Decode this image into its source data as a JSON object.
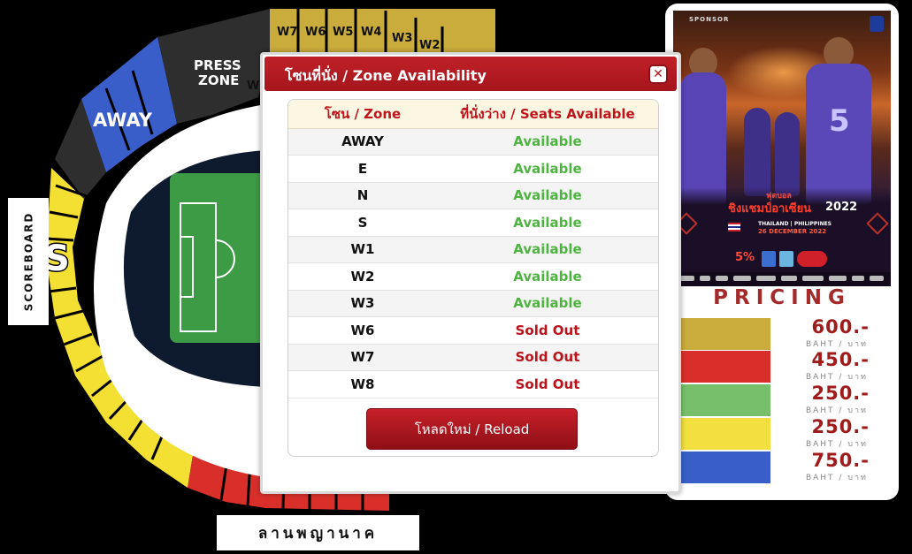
{
  "stadium": {
    "labels": {
      "away": "AWAY",
      "press": "PRESS",
      "press_zone": "ZONE",
      "s": "S",
      "w_partial": "W",
      "w_sections": [
        "W7",
        "W6",
        "W5",
        "W4",
        "W3",
        "W2"
      ]
    },
    "scoreboard": "SCOREBOARD",
    "lan": "ลานพญานาค",
    "colors": {
      "gold": "#c9ac3c",
      "red": "#d82f2b",
      "green": "#5fb04f",
      "yellow": "#f4e032",
      "blue": "#3a5ec9",
      "dark": "#2d2d2d",
      "pitch": "#3d9a45"
    }
  },
  "poster": {
    "brand": "SPONSOR",
    "jersey_number": "5",
    "subtitle": "ฟุตบอล",
    "title": "ชิงแชมป์อาเซียน",
    "year": "2022",
    "matchup": "THAILAND | PHILIPPINES",
    "date": "26 DECEMBER 2022",
    "promo": "5%"
  },
  "pricing": {
    "title": "PRICING",
    "unit": "BAHT / บาท",
    "tiers": [
      {
        "price": "600.-",
        "color": "#c9ac3c"
      },
      {
        "price": "450.-",
        "color": "#d82f2b"
      },
      {
        "price": "250.-",
        "color": "#77bf6b"
      },
      {
        "price": "250.-",
        "color": "#f1e040"
      },
      {
        "price": "750.-",
        "color": "#3a5ec9"
      }
    ]
  },
  "modal": {
    "title": "โซนที่นั่ง / Zone Availability",
    "close_icon": "close-icon",
    "headers": {
      "zone": "โซน / Zone",
      "seats": "ที่นั่งว่าง / Seats Available"
    },
    "rows": [
      {
        "zone": "AWAY",
        "status": "Available"
      },
      {
        "zone": "E",
        "status": "Available"
      },
      {
        "zone": "N",
        "status": "Available"
      },
      {
        "zone": "S",
        "status": "Available"
      },
      {
        "zone": "W1",
        "status": "Available"
      },
      {
        "zone": "W2",
        "status": "Available"
      },
      {
        "zone": "W3",
        "status": "Available"
      },
      {
        "zone": "W6",
        "status": "Sold Out"
      },
      {
        "zone": "W7",
        "status": "Sold Out"
      },
      {
        "zone": "W8",
        "status": "Sold Out"
      }
    ],
    "reload_label": "โหลดใหม่ / Reload",
    "colors": {
      "header": "#b0141b",
      "available": "#4fb341",
      "sold_out": "#b8141c"
    }
  }
}
